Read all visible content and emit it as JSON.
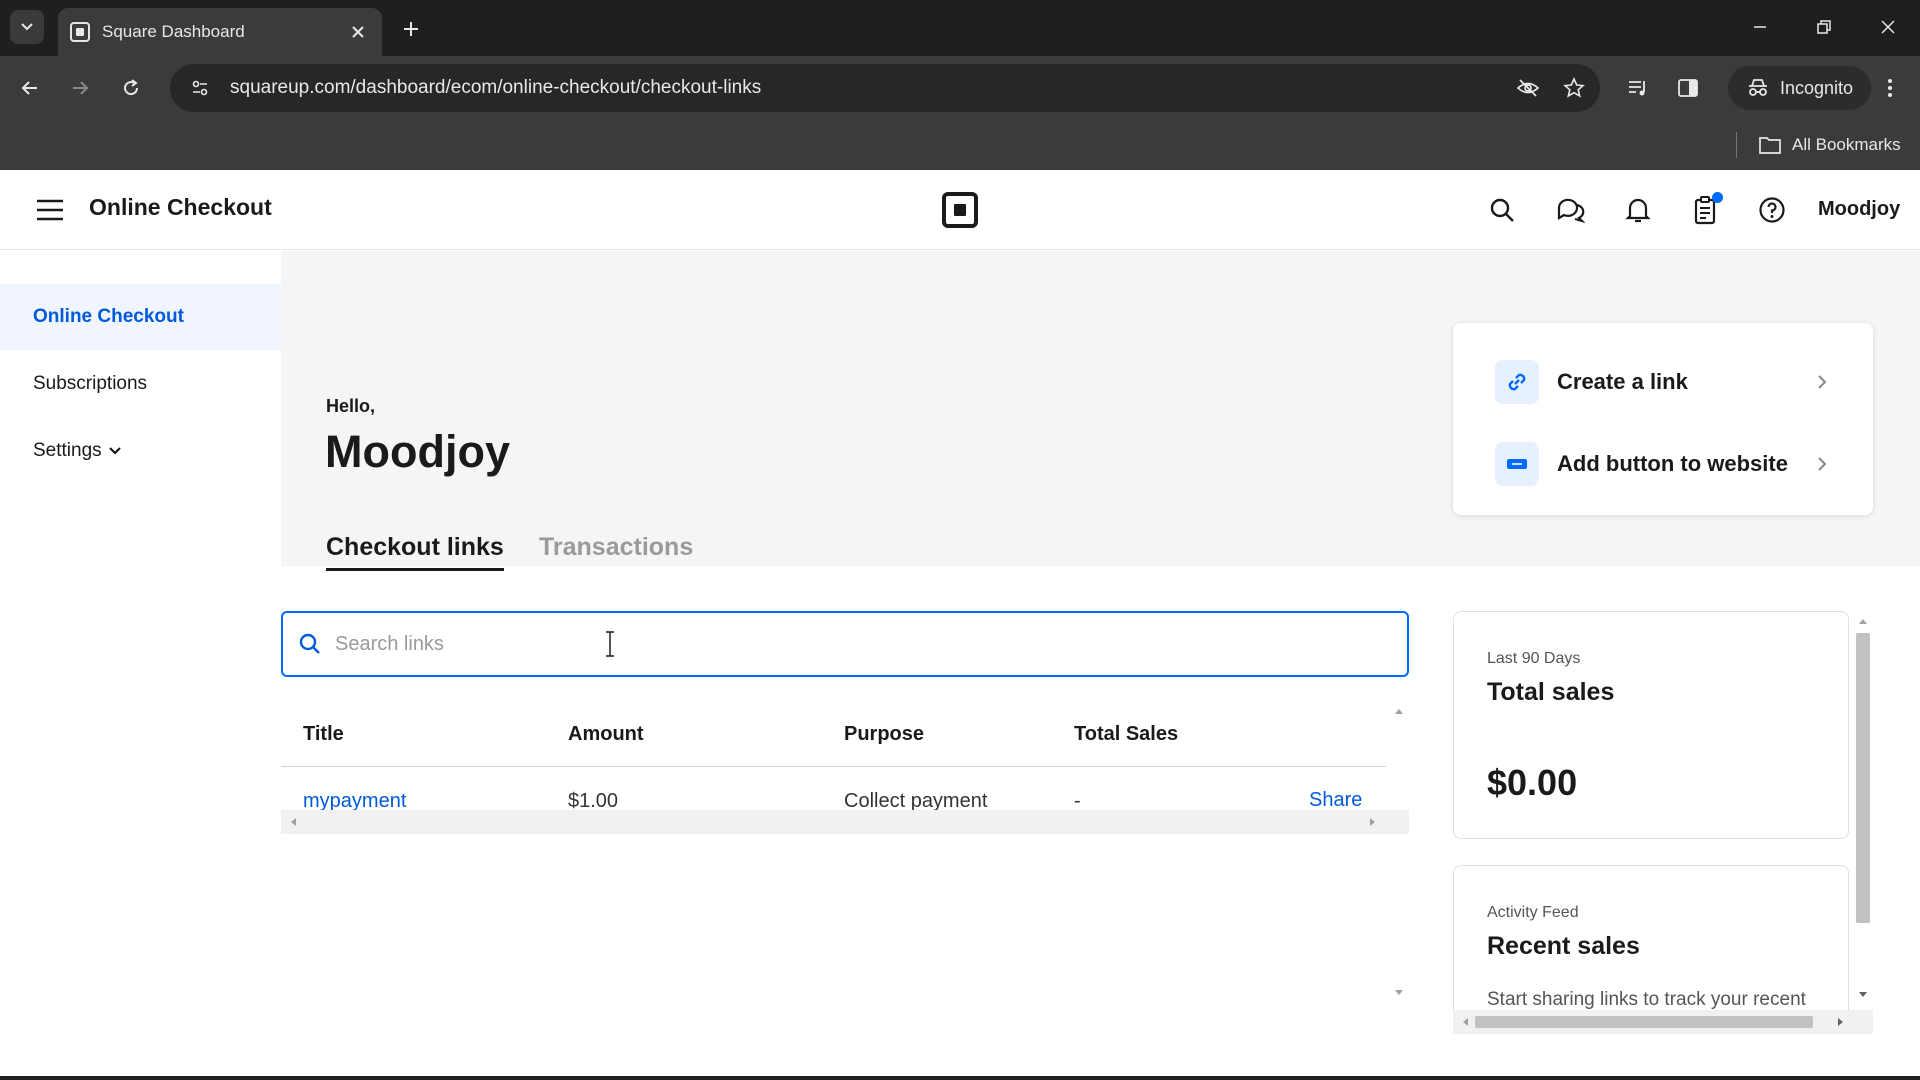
{
  "browser": {
    "tab_title": "Square Dashboard",
    "url": "squareup.com/dashboard/ecom/online-checkout/checkout-links",
    "incognito_label": "Incognito",
    "bookmarks_label": "All Bookmarks"
  },
  "header": {
    "title": "Online Checkout",
    "username": "Moodjoy",
    "notification_color": "#006aff"
  },
  "sidebar": {
    "items": [
      {
        "label": "Online Checkout",
        "active": true
      },
      {
        "label": "Subscriptions",
        "active": false
      },
      {
        "label": "Settings",
        "active": false
      }
    ]
  },
  "main": {
    "greeting": "Hello,",
    "name": "Moodjoy",
    "tabs": [
      {
        "label": "Checkout links",
        "active": true
      },
      {
        "label": "Transactions",
        "active": false
      }
    ],
    "search": {
      "placeholder": "Search links",
      "value": ""
    },
    "table": {
      "columns": [
        "Title",
        "Amount",
        "Purpose",
        "Total Sales"
      ],
      "rows": [
        {
          "title": "mypayment",
          "amount": "$1.00",
          "purpose": "Collect payment",
          "total_sales": "-",
          "action": "Share"
        }
      ]
    }
  },
  "actions": [
    {
      "label": "Create a link",
      "icon": "link-icon"
    },
    {
      "label": "Add button to website",
      "icon": "website-button-icon"
    }
  ],
  "stats": {
    "sales": {
      "period": "Last 90 Days",
      "title": "Total sales",
      "value": "$0.00"
    },
    "activity": {
      "kicker": "Activity Feed",
      "title": "Recent sales",
      "text": "Start sharing links to track your recent"
    }
  },
  "colors": {
    "accent": "#006aff",
    "link": "#005ad9",
    "chrome_dark": "#1f1f1f",
    "chrome_mid": "#3b3b3b"
  }
}
